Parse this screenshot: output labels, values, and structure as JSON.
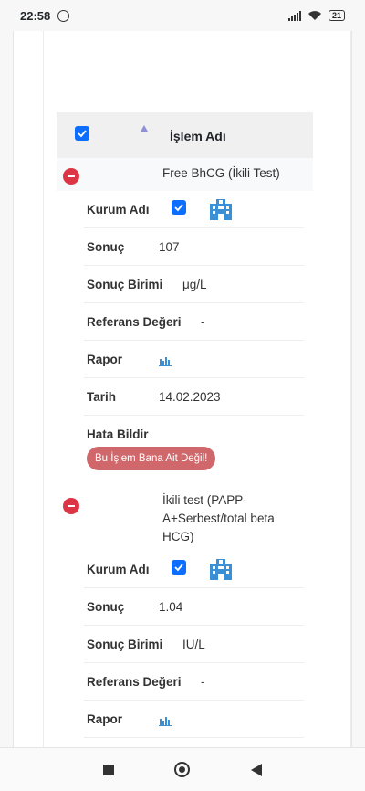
{
  "status_bar": {
    "time": "22:58",
    "battery": "21"
  },
  "table": {
    "header_title": "İşlem Adı",
    "groups": [
      {
        "name": "Free BhCG (İkili Test)",
        "rows": {
          "kurum_label": "Kurum Adı",
          "sonuc_label": "Sonuç",
          "sonuc_value": "107",
          "birim_label": "Sonuç Birimi",
          "birim_value": "μg/L",
          "referans_label": "Referans Değeri",
          "referans_value": "-",
          "rapor_label": "Rapor",
          "tarih_label": "Tarih",
          "tarih_value": "14.02.2023",
          "hata_label": "Hata Bildir",
          "hata_button": "Bu İşlem Bana Ait Değil!"
        }
      },
      {
        "name": "İkili test (PAPP-A+Serbest/total beta HCG)",
        "rows": {
          "kurum_label": "Kurum Adı",
          "sonuc_label": "Sonuç",
          "sonuc_value": "1.04",
          "birim_label": "Sonuç Birimi",
          "birim_value": "IU/L",
          "referans_label": "Referans Değeri",
          "referans_value": "-",
          "rapor_label": "Rapor"
        }
      }
    ]
  },
  "colors": {
    "checkbox": "#0d6efd",
    "minus": "#dc3545",
    "error_button": "#d0676b",
    "building_icon": "#3b8fd4",
    "chart_icon": "#3b8fd4"
  }
}
